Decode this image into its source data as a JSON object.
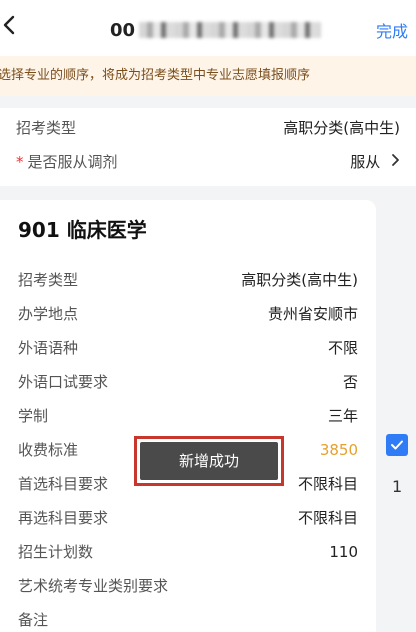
{
  "header": {
    "back_icon": "chevron-left-icon",
    "title_prefix": "00",
    "done_label": "完成"
  },
  "notice": {
    "text": "选择专业的顺序，将成为招考类型中专业志愿填报顺序"
  },
  "info": {
    "exam_type_label": "招考类型",
    "exam_type_value": "高职分类(高中生)",
    "adjust_label": "是否服从调剂",
    "adjust_required_mark": "*",
    "adjust_value": "服从"
  },
  "card": {
    "title": "901 临床医学",
    "fields": [
      {
        "label": "招考类型",
        "value": "高职分类(高中生)"
      },
      {
        "label": "办学地点",
        "value": "贵州省安顺市"
      },
      {
        "label": "外语语种",
        "value": "不限"
      },
      {
        "label": "外语口试要求",
        "value": "否"
      },
      {
        "label": "学制",
        "value": "三年"
      },
      {
        "label": "收费标准",
        "value": "3850"
      },
      {
        "label": "首选科目要求",
        "value": "不限科目"
      },
      {
        "label": "再选科目要求",
        "value": "不限科目"
      },
      {
        "label": "招生计划数",
        "value": "110"
      },
      {
        "label": "艺术统考专业类别要求",
        "value": ""
      },
      {
        "label": "备注",
        "value": ""
      }
    ]
  },
  "toast": {
    "text": "新增成功"
  },
  "side": {
    "checked": true,
    "number": "1"
  },
  "colors": {
    "accent": "#2f7cf6",
    "fee": "#e8a02c",
    "notice_bg": "#fff4e8",
    "highlight": "#c8372d"
  }
}
